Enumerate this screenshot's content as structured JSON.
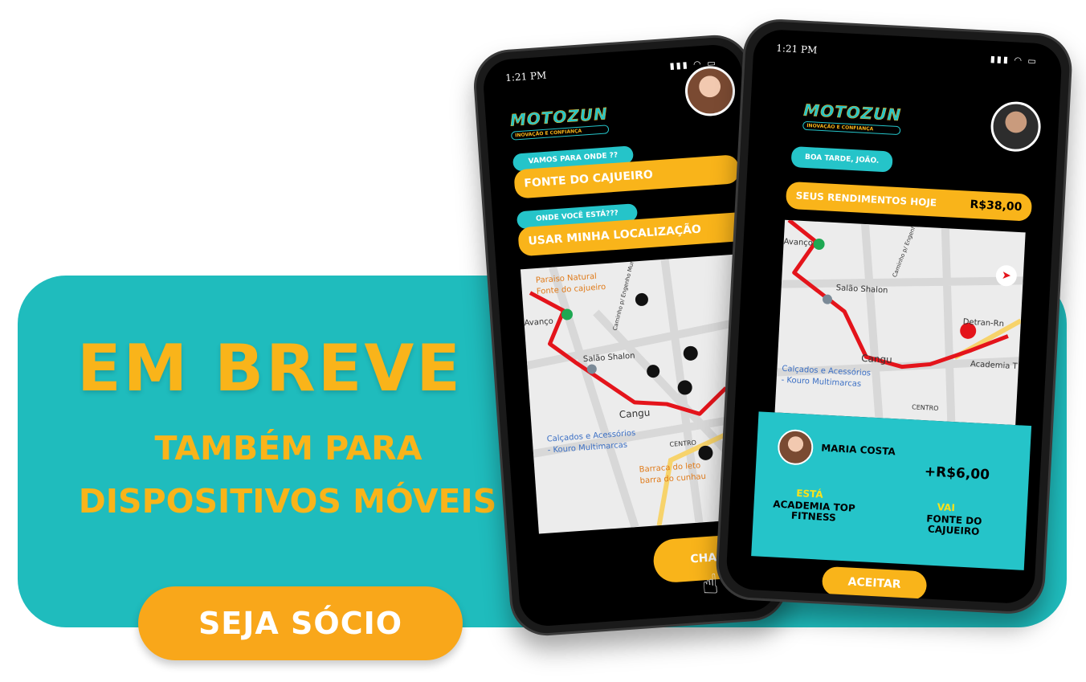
{
  "promo": {
    "headline": "EM BREVE",
    "sub_line1": "TAMBÉM PARA",
    "sub_line2": "DISPOSITIVOS MÓVEIS",
    "cta_label": "SEJA SÓCIO"
  },
  "colors": {
    "teal": "#1fbcbd",
    "orange": "#f9b41a",
    "route": "#e4141b"
  },
  "phone_left": {
    "time": "1:21 PM",
    "logo": "MOTOZUN",
    "logo_tagline": "INOVAÇÃO E CONFIANÇA",
    "dest_prompt": "VAMOS PARA ONDE ??",
    "dest_value": "FONTE DO CAJUEIRO",
    "origin_prompt": "ONDE VOCÊ ESTÁ???",
    "origin_value": "USAR MINHA LOCALIZAÇÃO",
    "map_labels": {
      "paraiso": "Paraiso Natural",
      "fonte": "Fonte do cajueiro",
      "avanco": "Avanço",
      "salao": "Salão Shalon",
      "road": "Caminho p/ Engenho Murim",
      "cangu": "Cangu",
      "calcados": "Calçados e Acessórios",
      "kouro": "- Kouro Multimarcas",
      "centro": "CENTRO",
      "barraca": "Barraca do leto",
      "barra": "barra do cunhau"
    },
    "call_button": "CHAMAR"
  },
  "phone_right": {
    "time": "1:21 PM",
    "logo": "MOTOZUN",
    "logo_tagline": "INOVAÇÃO E CONFIANÇA",
    "greeting": "BOA TARDE, JOÃO.",
    "earnings_label": "SEUS RENDIMENTOS HOJE",
    "earnings_value": "R$38,00",
    "map_labels": {
      "avanco": "Avanço",
      "salao": "Salão Shalon",
      "road": "Caminho p/ Engenho Murim",
      "detran": "Detran-Rn",
      "cangu": "Cangu",
      "academia": "Academia T",
      "calcados": "Calçados e Acessórios",
      "kouro": "- Kouro Multimarcas",
      "centro": "CENTRO"
    },
    "ride": {
      "passenger": "MARIA COSTA",
      "fare": "+R$6,00",
      "from_label": "ESTÁ",
      "from_place": "ACADEMIA TOP FITNESS",
      "to_label": "VAI",
      "to_place": "FONTE DO CAJUEIRO"
    },
    "accept_button": "ACEITAR"
  }
}
